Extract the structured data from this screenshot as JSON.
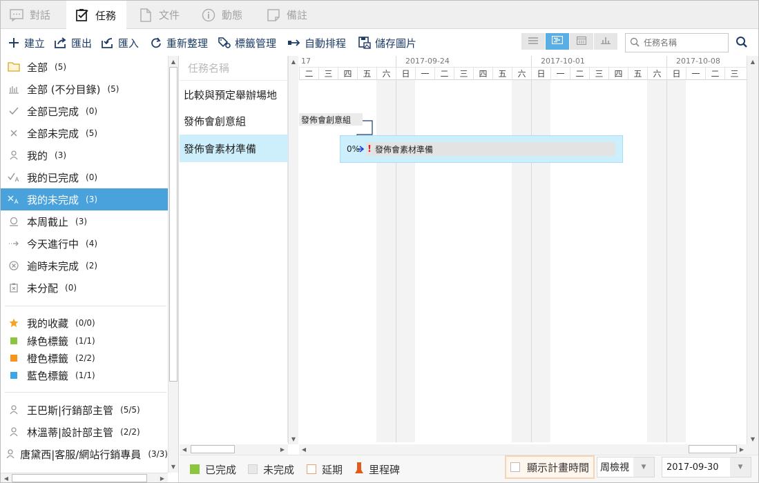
{
  "tabs": [
    {
      "label": "對話",
      "icon": "chat-icon",
      "active": false
    },
    {
      "label": "任務",
      "icon": "task-icon",
      "active": true
    },
    {
      "label": "文件",
      "icon": "document-icon",
      "active": false
    },
    {
      "label": "動態",
      "icon": "info-icon",
      "active": false
    },
    {
      "label": "備註",
      "icon": "note-icon",
      "active": false
    }
  ],
  "toolbar": {
    "create": "建立",
    "export": "匯出",
    "import": "匯入",
    "refresh": "重新整理",
    "tags": "標籤管理",
    "auto_schedule": "自動排程",
    "save_image": "儲存圖片"
  },
  "search": {
    "placeholder": "任務名稱"
  },
  "sidebar": {
    "groups": [
      {
        "label": "全部",
        "count": "(5)",
        "icon": "folder-icon"
      },
      {
        "label": "全部 (不分目錄)",
        "count": "(5)",
        "icon": "bars-icon"
      },
      {
        "label": "全部已完成",
        "count": "(0)",
        "icon": "check-icon"
      },
      {
        "label": "全部未完成",
        "count": "(5)",
        "icon": "cross-icon"
      },
      {
        "label": "我的",
        "count": "(3)",
        "icon": "user-icon"
      },
      {
        "label": "我的已完成",
        "count": "(0)",
        "icon": "user-check-icon"
      },
      {
        "label": "我的未完成",
        "count": "(3)",
        "icon": "user-cross-icon"
      },
      {
        "label": "本周截止",
        "count": "(3)",
        "icon": "deadline-icon"
      },
      {
        "label": "今天進行中",
        "count": "(4)",
        "icon": "progress-arrow-icon"
      },
      {
        "label": "逾時未完成",
        "count": "(2)",
        "icon": "overdue-icon"
      },
      {
        "label": "未分配",
        "count": "(0)",
        "icon": "unassigned-icon"
      }
    ],
    "tags": [
      {
        "label": "我的收藏",
        "count": "(0/0)",
        "color": "#f3a521",
        "icon": "star-icon"
      },
      {
        "label": "綠色標籤",
        "count": "(1/1)",
        "color": "#8bc63f",
        "icon": "green-tag-icon"
      },
      {
        "label": "橙色標籤",
        "count": "(2/2)",
        "color": "#f7941d",
        "icon": "orange-tag-icon"
      },
      {
        "label": "藍色標籤",
        "count": "(1/1)",
        "color": "#3aa7e8",
        "icon": "blue-tag-icon"
      }
    ],
    "members": [
      {
        "label": "王巴斯|行銷部主管",
        "count": "(5/5)"
      },
      {
        "label": "林溫蒂|設計部主管",
        "count": "(2/2)"
      },
      {
        "label": "唐黛西|客服/網站行銷專員",
        "count": "(3/3)"
      }
    ]
  },
  "tasklist": {
    "header": "任務名稱",
    "rows": [
      "比較與預定舉辦場地",
      "發佈會創意組",
      "發佈會素材準備"
    ]
  },
  "gantt": {
    "first_week_label": "17",
    "week_labels": [
      "2017-09-24",
      "2017-10-01",
      "2017-10-08"
    ],
    "day_labels": [
      "二",
      "三",
      "四",
      "五",
      "六",
      "日",
      "一",
      "二",
      "三",
      "四",
      "五",
      "六",
      "日",
      "一",
      "二",
      "三",
      "四",
      "五",
      "六",
      "日",
      "一",
      "二",
      "三"
    ],
    "bar1_label": "發佈會創意組",
    "bar2_percent": "0%",
    "bar2_label": "發佈會素材準備",
    "warning": "!"
  },
  "legend": {
    "done": "已完成",
    "undone": "未完成",
    "delayed": "延期",
    "milestone": "里程碑",
    "show_plan_time": "顯示計畫時間",
    "view_mode": "周檢視",
    "date": "2017-09-30"
  },
  "colors": {
    "accent": "#4aa2dd",
    "done": "#8bc63f",
    "undone": "#e8e8e8",
    "delayed": "#e8a078",
    "milestone": "#e15a1b",
    "selected_row": "#cdeefb"
  }
}
